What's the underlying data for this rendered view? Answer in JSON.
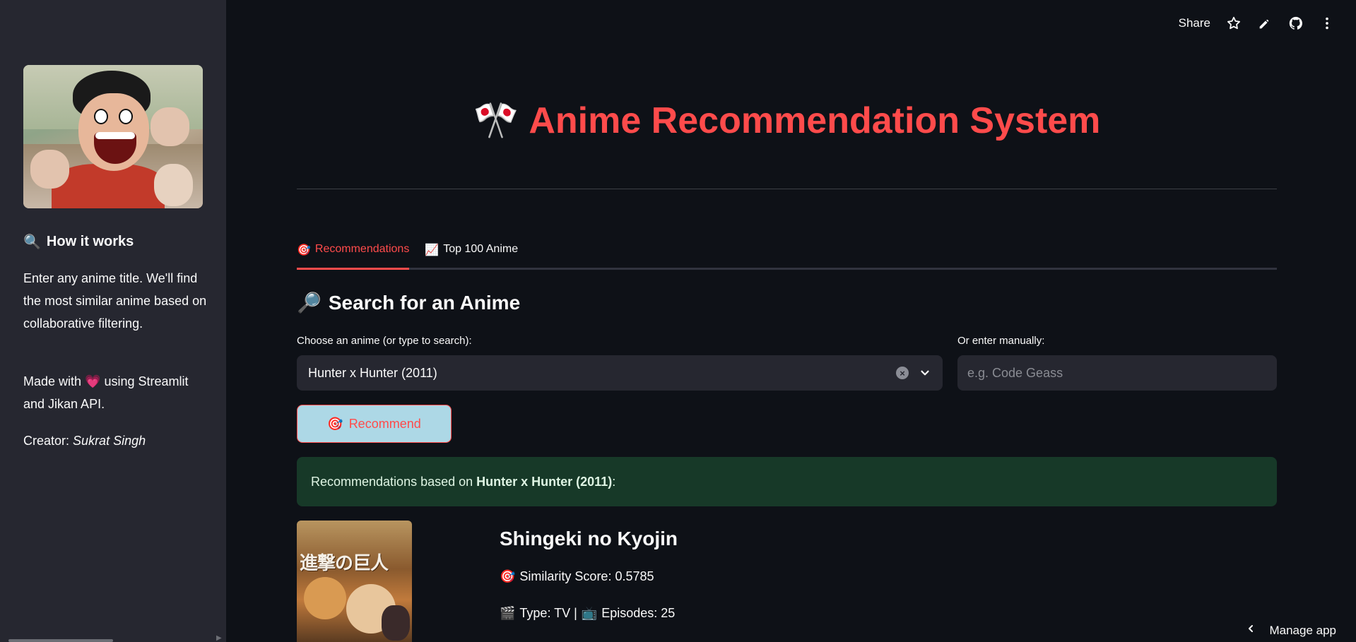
{
  "toolbar": {
    "share_label": "Share",
    "icons": [
      "star-icon",
      "pencil-icon",
      "github-icon",
      "kebab-menu-icon"
    ]
  },
  "sidebar": {
    "heading_icon": "🔍",
    "heading": "How it works",
    "description": "Enter any anime title. We'll find the most similar anime based on collaborative filtering.",
    "made_with_prefix": "Made with",
    "heart": "💗",
    "made_with_suffix": "using Streamlit and Jikan API.",
    "creator_label": "Creator:",
    "creator_name": "Sukrat Singh"
  },
  "main": {
    "title_icon": "🎌",
    "title": "Anime Recommendation System",
    "tabs": [
      {
        "icon": "🎯",
        "label": "Recommendations",
        "active": true
      },
      {
        "icon": "📈",
        "label": "Top 100 Anime",
        "active": false
      }
    ],
    "search_heading_icon": "🔎",
    "search_heading": "Search for an Anime",
    "select_label": "Choose an anime (or type to search):",
    "select_value": "Hunter x Hunter (2011)",
    "manual_label": "Or enter manually:",
    "manual_placeholder": "e.g. Code Geass",
    "recommend_icon": "🎯",
    "recommend_label": "Recommend",
    "result_prefix": "Recommendations based on",
    "result_anime": "Hunter x Hunter (2011)",
    "result_suffix": ":",
    "results": [
      {
        "title": "Shingeki no Kyojin",
        "poster_text": "進撃の巨人",
        "score_icon": "🎯",
        "score_label": "Similarity Score: 0.5785",
        "type_icon": "🎬",
        "type_label": "Type: TV |",
        "episodes_icon": "📺",
        "episodes_label": "Episodes: 25"
      }
    ]
  },
  "footer": {
    "manage_app": "Manage app"
  },
  "colors": {
    "accent": "#ff4b4b",
    "background": "#0e1117",
    "sidebar": "#262730",
    "success_bg": "#173928",
    "button_bg": "#add8e6"
  }
}
